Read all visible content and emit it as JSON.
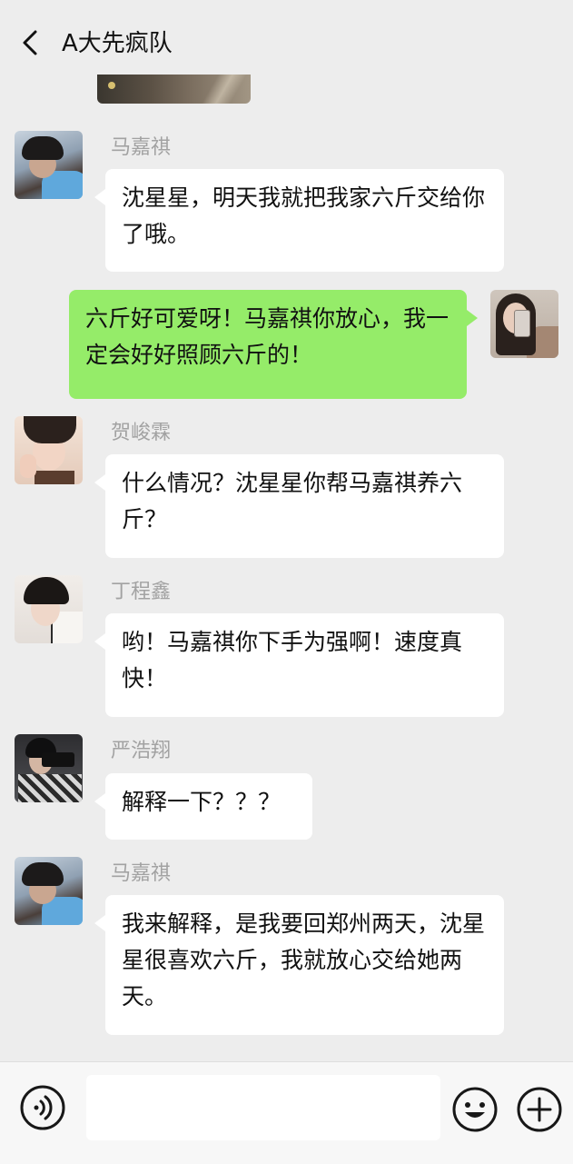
{
  "header": {
    "title": "A大先疯队",
    "back_icon": "chevron-left-icon"
  },
  "messages": [
    {
      "sender": "马嘉祺",
      "direction": "received",
      "text": "沈星星，明天我就把我家六斤交给你了哦。"
    },
    {
      "sender": "",
      "direction": "sent",
      "text": "六斤好可爱呀！马嘉祺你放心，我一定会好好照顾六斤的！"
    },
    {
      "sender": "贺峻霖",
      "direction": "received",
      "text": "什么情况？沈星星你帮马嘉祺养六斤？"
    },
    {
      "sender": "丁程鑫",
      "direction": "received",
      "text": "哟！马嘉祺你下手为强啊！速度真快！"
    },
    {
      "sender": "严浩翔",
      "direction": "received",
      "text": "解释一下？？？"
    },
    {
      "sender": "马嘉祺",
      "direction": "received",
      "text": "我来解释，是我要回郑州两天，沈星星很喜欢六斤，我就放心交给她两天。"
    }
  ],
  "footer": {
    "input_value": "",
    "voice_icon": "voice-icon",
    "emoji_icon": "emoji-icon",
    "plus_icon": "plus-icon"
  },
  "colors": {
    "background": "#ededed",
    "sent_bubble": "#95ec69",
    "received_bubble": "#ffffff",
    "sender_name": "#a2a2a2"
  }
}
